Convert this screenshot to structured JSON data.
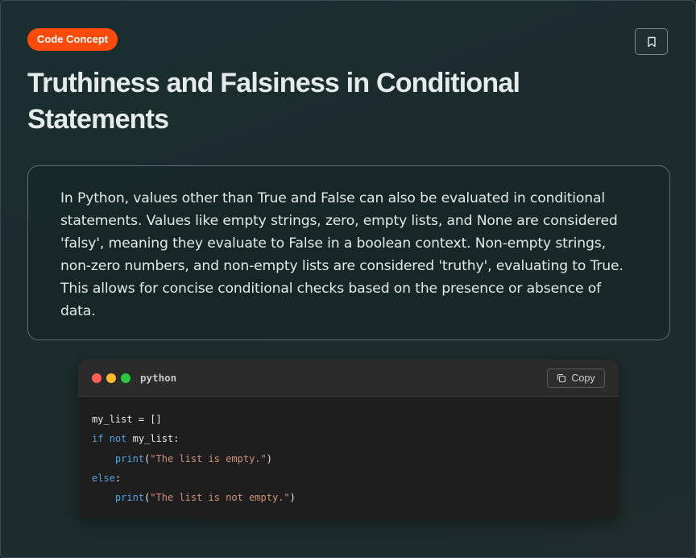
{
  "badge": {
    "label": "Code Concept"
  },
  "header": {
    "title": "Truthiness and Falsiness in Conditional Statements",
    "bookmark_icon": "bookmark-icon"
  },
  "description": {
    "text": "In Python, values other than True and False can also be evaluated in conditional statements. Values like empty strings, zero, empty lists, and None are considered 'falsy', meaning they evaluate to False in a boolean context. Non-empty strings, non-zero numbers, and non-empty lists are considered 'truthy', evaluating to True. This allows for concise conditional checks based on the presence or absence of data."
  },
  "code_block": {
    "language": "python",
    "copy_label": "Copy",
    "lines": {
      "l1": "my_list = []",
      "l2_kw1": "if",
      "l2_kw2": "not",
      "l2_rest": " my_list:",
      "l3_fn": "print",
      "l3_str": "\"The list is empty.\"",
      "l4_kw": "else",
      "l4_rest": ":",
      "l5_fn": "print",
      "l5_str": "\"The list is not empty.\""
    }
  },
  "colors": {
    "badge_bg": "#ff4b0a",
    "card_bg": "#1b2a2b",
    "code_bg": "#1e1e1e",
    "keyword": "#569cd6",
    "string": "#ce9178"
  }
}
